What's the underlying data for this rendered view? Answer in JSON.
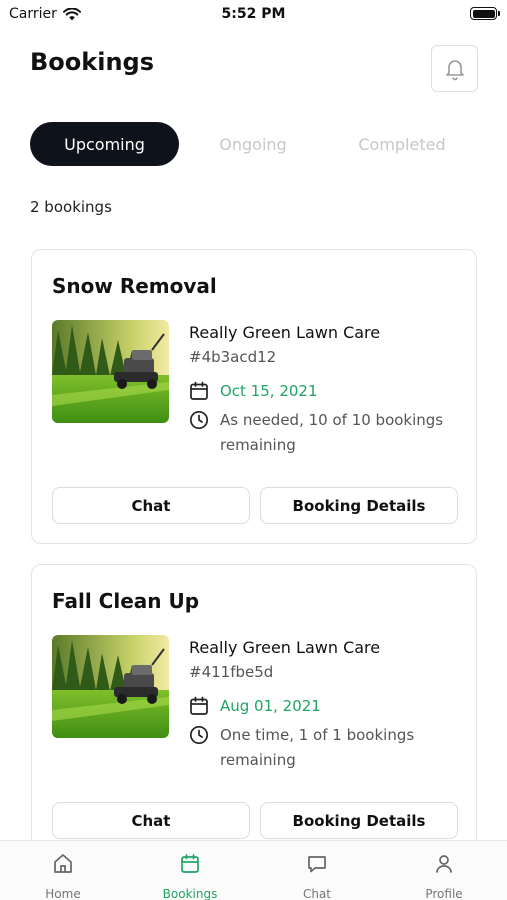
{
  "status_bar": {
    "carrier": "Carrier",
    "time": "5:52 PM"
  },
  "header": {
    "title": "Bookings",
    "bell_icon": "bell-icon"
  },
  "tabs": [
    {
      "label": "Upcoming",
      "active": true
    },
    {
      "label": "Ongoing",
      "active": false
    },
    {
      "label": "Completed",
      "active": false
    }
  ],
  "bookings_count": "2 bookings",
  "bookings": [
    {
      "title": "Snow Removal",
      "provider": "Really Green Lawn Care",
      "id": "#4b3acd12",
      "date": "Oct 15, 2021",
      "frequency": "As needed, 10 of 10 bookings remaining",
      "chat_label": "Chat",
      "details_label": "Booking Details"
    },
    {
      "title": "Fall Clean Up",
      "provider": "Really Green Lawn Care",
      "id": "#411fbe5d",
      "date": "Aug 01, 2021",
      "frequency": "One time, 1 of 1 bookings remaining",
      "chat_label": "Chat",
      "details_label": "Booking Details"
    }
  ],
  "nav": [
    {
      "label": "Home",
      "icon": "home-icon"
    },
    {
      "label": "Bookings",
      "icon": "calendar-icon",
      "active": true
    },
    {
      "label": "Chat",
      "icon": "chat-bubble-icon"
    },
    {
      "label": "Profile",
      "icon": "person-icon"
    }
  ],
  "colors": {
    "accent": "#1fa463",
    "tab_active_bg": "#0e121b",
    "inactive_tab": "#c8c8c8"
  }
}
